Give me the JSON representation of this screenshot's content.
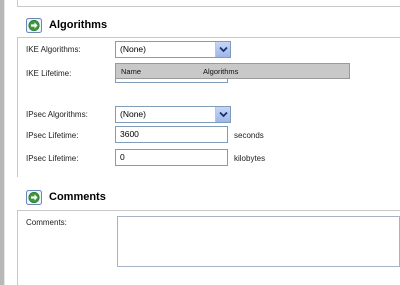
{
  "sections": {
    "algorithms": {
      "title": "Algorithms",
      "icon": "arrow-right-icon"
    },
    "comments": {
      "title": "Comments",
      "icon": "arrow-right-icon"
    }
  },
  "ike": {
    "algorithms_label": "IKE Algorithms:",
    "algorithms_value": "(None)",
    "lifetime_label": "IKE Lifetime:",
    "dropdown_columns": [
      "Name",
      "Algorithms"
    ]
  },
  "ipsec": {
    "algorithms_label": "IPsec Algorithms:",
    "algorithms_value": "(None)",
    "lifetime_seconds_label": "IPsec Lifetime:",
    "lifetime_seconds_value": "3600",
    "lifetime_seconds_unit": "seconds",
    "lifetime_kb_label": "IPsec Lifetime:",
    "lifetime_kb_value": "0",
    "lifetime_kb_unit": "kilobytes"
  },
  "comments": {
    "label": "Comments:",
    "value": ""
  },
  "colors": {
    "accent_green": "#3a9a3a",
    "dropdown_button": "#9eb7ea",
    "border": "#7f9db9"
  }
}
